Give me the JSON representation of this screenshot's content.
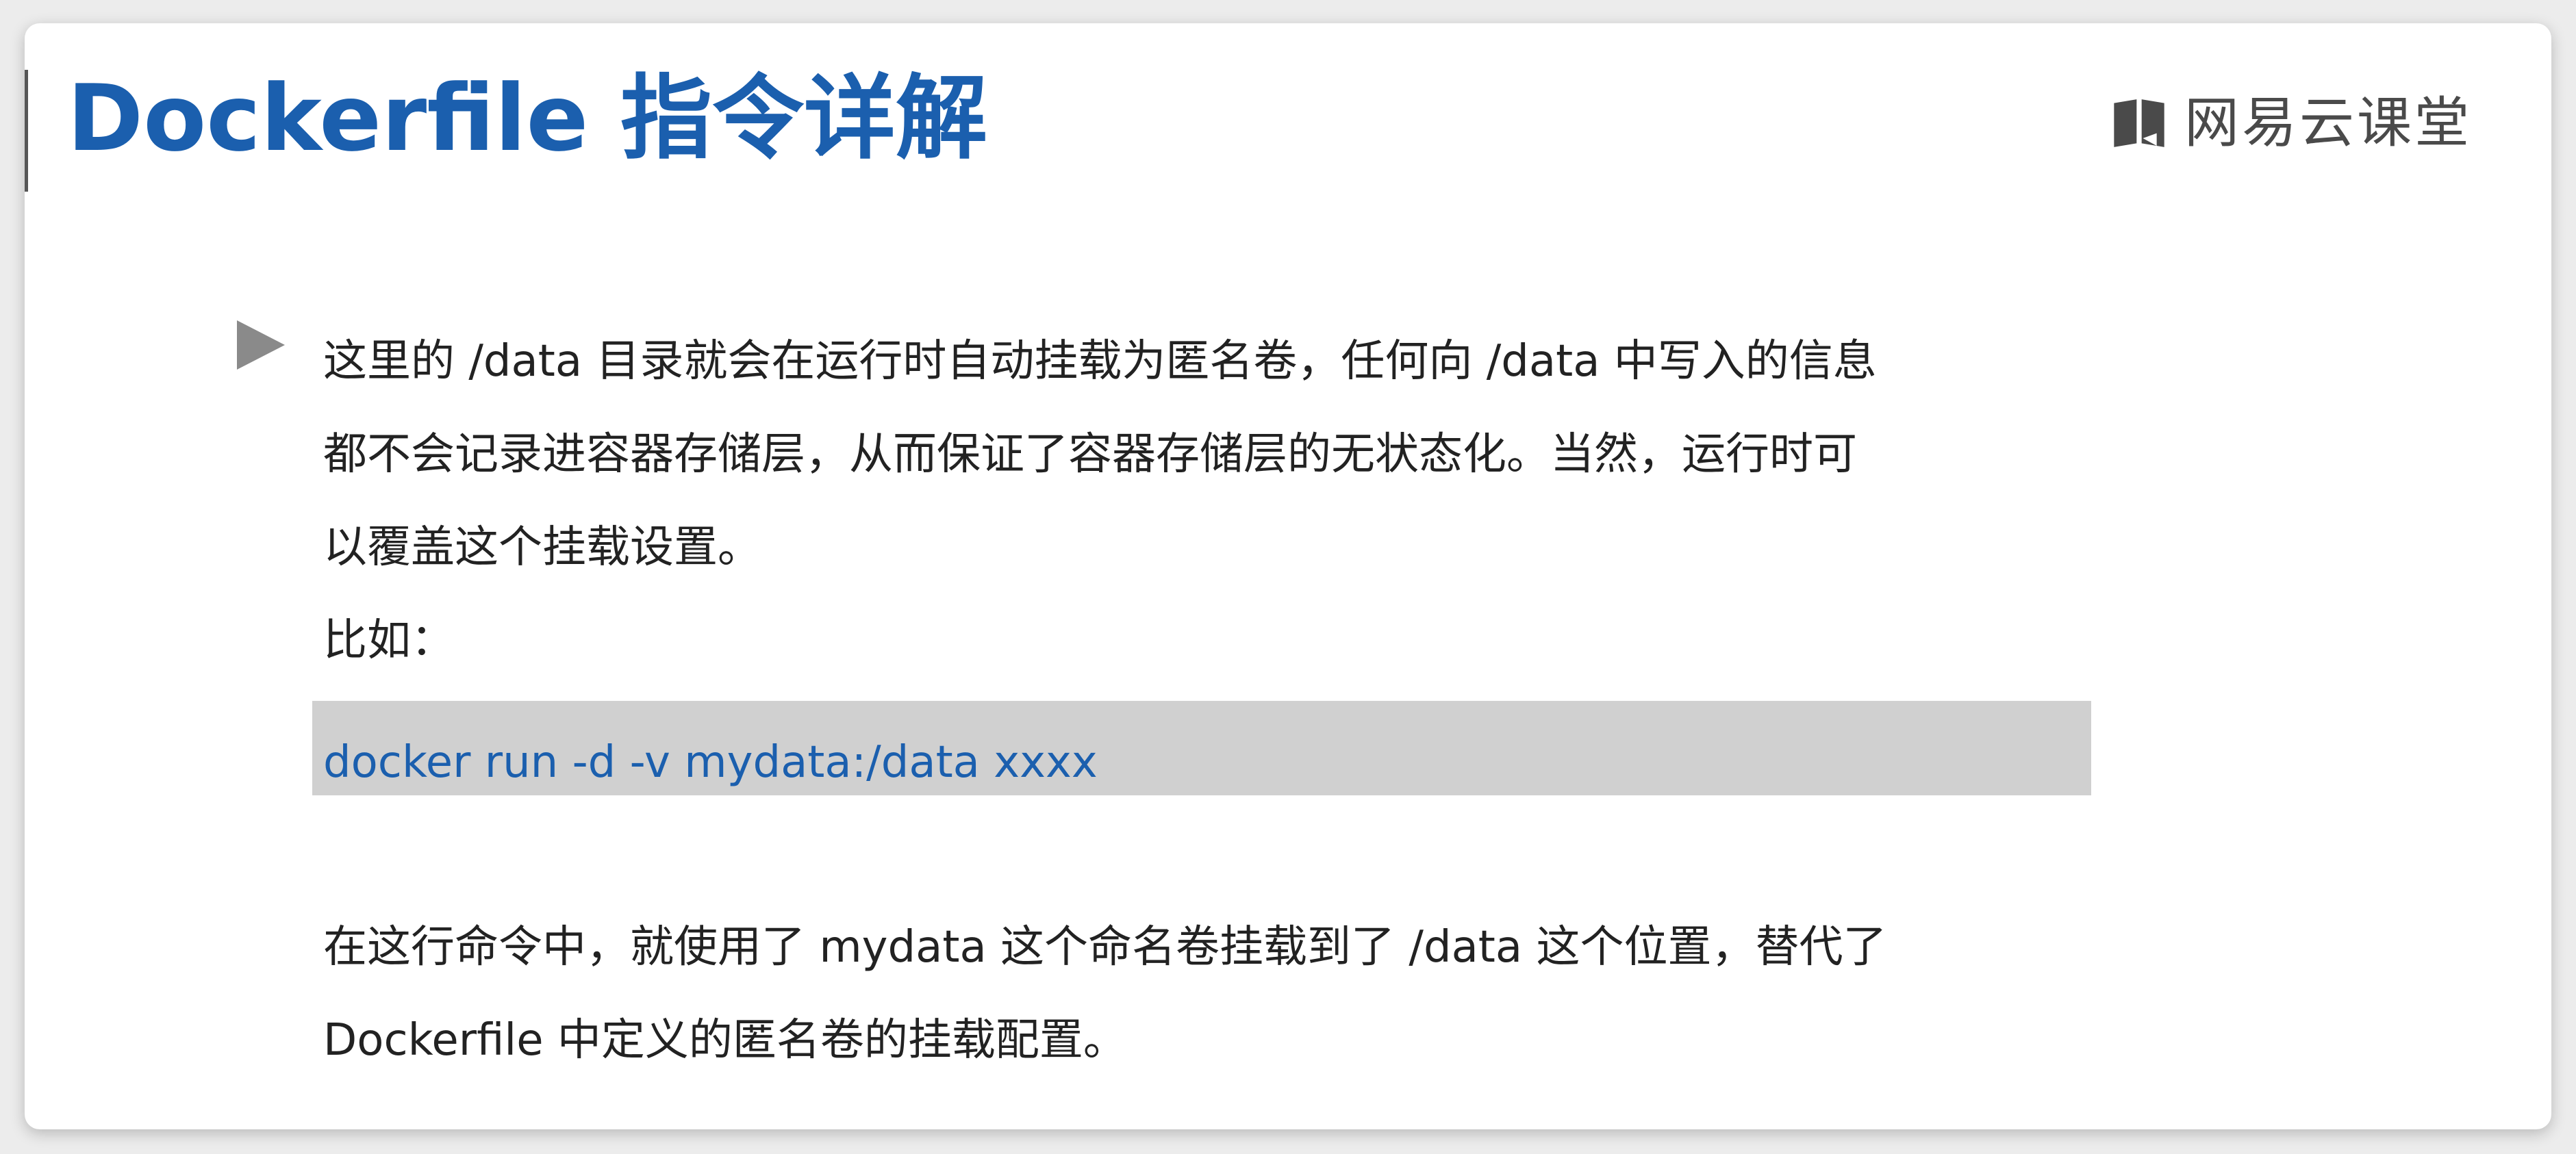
{
  "slide": {
    "title": "Dockerfile 指令详解",
    "brand": {
      "icon": "book-icon",
      "name": "网易云课堂"
    },
    "bullet": {
      "icon": "triangle-right-icon",
      "lines": [
        "这里的 /data 目录就会在运行时自动挂载为匿名卷，任何向 /data 中写入的信息",
        "都不会记录进容器存储层，从而保证了容器存储层的无状态化。当然，运行时可",
        "以覆盖这个挂载设置。",
        "比如："
      ]
    },
    "code": "docker run -d -v mydata:/data xxxx",
    "explanation": {
      "lines": [
        "在这行命令中，就使用了 mydata 这个命名卷挂载到了 /data 这个位置，替代了",
        "Dockerfile 中定义的匿名卷的挂载配置。"
      ]
    }
  },
  "colors": {
    "title": "#1b5fae",
    "code_text": "#1b5fae",
    "code_background": "#d0d0d0",
    "body_text": "#222222",
    "brand": "#4a4a4a"
  }
}
